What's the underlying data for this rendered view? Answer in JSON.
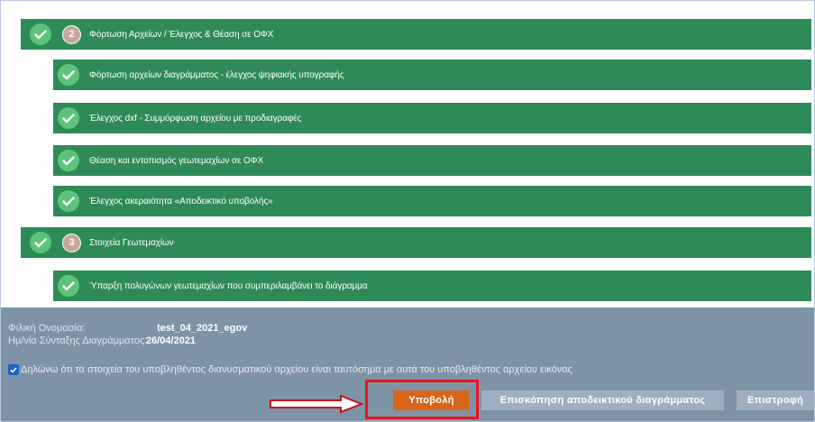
{
  "steps": {
    "step2": {
      "number": "2",
      "label": "Φόρτωση Αρχείων / Έλεγχος & Θέαση σε ΟΦΧ",
      "items": [
        "Φόρτωση αρχείων διαγράμματος - έλεγχος ψηφιακής υπογραφής",
        "Έλεγχος dxf - Συμμόρφωση αρχείου με προδιαγραφές",
        "Θέαση και εντοπισμός γεωτεμαχίων σε ΟΦΧ",
        "Έλεγχος ακεραιότητα «Αποδεικτικό υποβολής»"
      ]
    },
    "step3": {
      "number": "3",
      "label": "Στοιχεία Γεωτεμαχίων",
      "items": [
        "Ύπαρξη πολυγώνων γεωτεμαχίων που συμπεριλαμβάνει το διάγραμμα"
      ]
    }
  },
  "footer": {
    "friendly_name_label": "Φιλική Ονομασία:",
    "friendly_name_value": "test_04_2021_egov",
    "date_label": "Ημ/νία Σύνταξης Διαγράμματος:",
    "date_value": "26/04/2021",
    "declaration": "Δηλώνω ότι τα στοιχεία του υποβληθέντος διανυσματικού αρχείου είναι ταυτόσημα με αυτά του υποβληθέντος αρχείου εικόνας",
    "declaration_checked": true
  },
  "buttons": {
    "submit": "Υποβολή",
    "preview": "Επισκόπηση αποδεικτικού διαγράμματος",
    "back": "Επιστροφή"
  },
  "colors": {
    "step_bar": "#2e8b57",
    "check_circle": "#5cc47a",
    "footer_bg": "#7f93a7",
    "submit_bg": "#d8661a",
    "secondary_btn_bg": "#a0afbf",
    "annotation_red": "#e8141c"
  }
}
